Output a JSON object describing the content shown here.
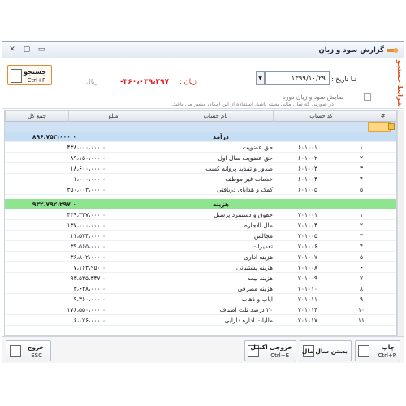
{
  "window": {
    "title": "گزارش سود و زیان"
  },
  "filters": {
    "panel_label": "شرایط جستجو",
    "date_label": "تـا تاریخ :",
    "date_value": "۱۳۹۹/۱۰/۲۹",
    "loss_label": "زیان :",
    "loss_value": "-۳۶۰،۰۳۹،۲۹۷",
    "currency": "ریال",
    "checkbox_label": "نمایش سود و زیان دوره",
    "hint": "در صورتی که سال مالی بسته باشد، استفاده از این امکان میسر می باشد.",
    "search_button": {
      "label": "جستجو",
      "shortcut": "Ctrl+F"
    }
  },
  "grid": {
    "columns": {
      "no": "#",
      "code": "کد حساب",
      "name": "نام حساب",
      "amount": "مبلغ",
      "total": "جمع کل"
    },
    "groups": [
      {
        "title": "درآمد",
        "total": "۸۹۶،۷۵۳،۰۰۰ ۰",
        "style": "blue",
        "rows": [
          {
            "no": "۱",
            "code": "۶۰۱۰۰۱",
            "name": "حق عضویت",
            "amount": "۴۳۸،۰۰۰،۰۰۰ ۰"
          },
          {
            "no": "۲",
            "code": "۶۰۱۰۰۲",
            "name": "حق عضویت سال اول",
            "amount": "۸۹،۱۵۰،۰۰۰ ۰"
          },
          {
            "no": "۳",
            "code": "۶۰۱۰۰۳",
            "name": "صدور و تمدید پروانه کسب",
            "amount": "۱۸،۶۰۰،۰۰۰ ۰"
          },
          {
            "no": "۴",
            "code": "۶۰۱۰۰۴",
            "name": "خدمات غیر موظف",
            "amount": "۱،۰۰۰،۰۰۰ ۰"
          },
          {
            "no": "۵",
            "code": "۶۰۱۰۰۵",
            "name": "کمک و هدایای دریافتی",
            "amount": "۳۵۰،۰۰۳،۰۰۰ ۰"
          }
        ]
      },
      {
        "title": "هزینه",
        "total": "۹۳۲،۷۹۲،۲۹۷ ۰",
        "style": "green",
        "rows": [
          {
            "no": "۱",
            "code": "۷۰۱۰۰۱",
            "name": "حقوق و دستمزد پرسنل",
            "amount": "۴۳۹،۳۳۷،۰۰۰ ۰"
          },
          {
            "no": "۲",
            "code": "۷۰۱۰۰۴",
            "name": "مال الاجاره",
            "amount": "۱۳۷،۰۰۰،۰۰۰ ۰"
          },
          {
            "no": "۳",
            "code": "۷۰۱۰۰۵",
            "name": "مجالس",
            "amount": "۱۱،۵۷۴،۰۰۰ ۰"
          },
          {
            "no": "۴",
            "code": "۷۰۱۰۰۶",
            "name": "تعمیرات",
            "amount": "۳۹،۵۶۵،۰۰۰ ۰"
          },
          {
            "no": "۵",
            "code": "۷۰۱۰۰۷",
            "name": "هزینه اداری",
            "amount": "۳۶،۸۰۲،۰۰۰ ۰"
          },
          {
            "no": "۶",
            "code": "۷۰۱۰۰۸",
            "name": "هزینه پشتیبانی",
            "amount": "۷،۱۶۳،۹۵۰ ۰"
          },
          {
            "no": "۷",
            "code": "۷۰۱۰۰۹",
            "name": "هزینه بیمه",
            "amount": "۹۳،۵۳۵،۳۴۷ ۰"
          },
          {
            "no": "۸",
            "code": "۷۰۱۰۱۰",
            "name": "هزینه مصرفی",
            "amount": "۳،۶۳۸،۰۰۰ ۰"
          },
          {
            "no": "۹",
            "code": "۷۰۱۰۱۱",
            "name": "ایاب و ذهاب",
            "amount": "۹،۳۶۰،۰۰۰ ۰"
          },
          {
            "no": "۱۰",
            "code": "۷۰۱۰۱۴",
            "name": "۲۰ درصد ثلث اصناف",
            "amount": "۱۷۶،۵۵۰،۰۰۰ ۰"
          },
          {
            "no": "۱۱",
            "code": "۷۰۱۰۱۷",
            "name": "مالیات اداره دارایی",
            "amount": "۶،۰۷۶،۰۰۰ ۰"
          }
        ]
      }
    ]
  },
  "footer": {
    "print": {
      "label": "چاپ",
      "shortcut": "Ctrl+P"
    },
    "close_year": {
      "label": "بستن سال مال"
    },
    "excel": {
      "label": "خروجی اکسل",
      "shortcut": "Ctrl+E"
    },
    "exit": {
      "label": "خروج",
      "shortcut": "ESC"
    }
  },
  "colors": {
    "accent": "#e08c3a",
    "loss": "#dd2222",
    "group_blue": "#c6def3",
    "group_green": "#8fe58f"
  }
}
